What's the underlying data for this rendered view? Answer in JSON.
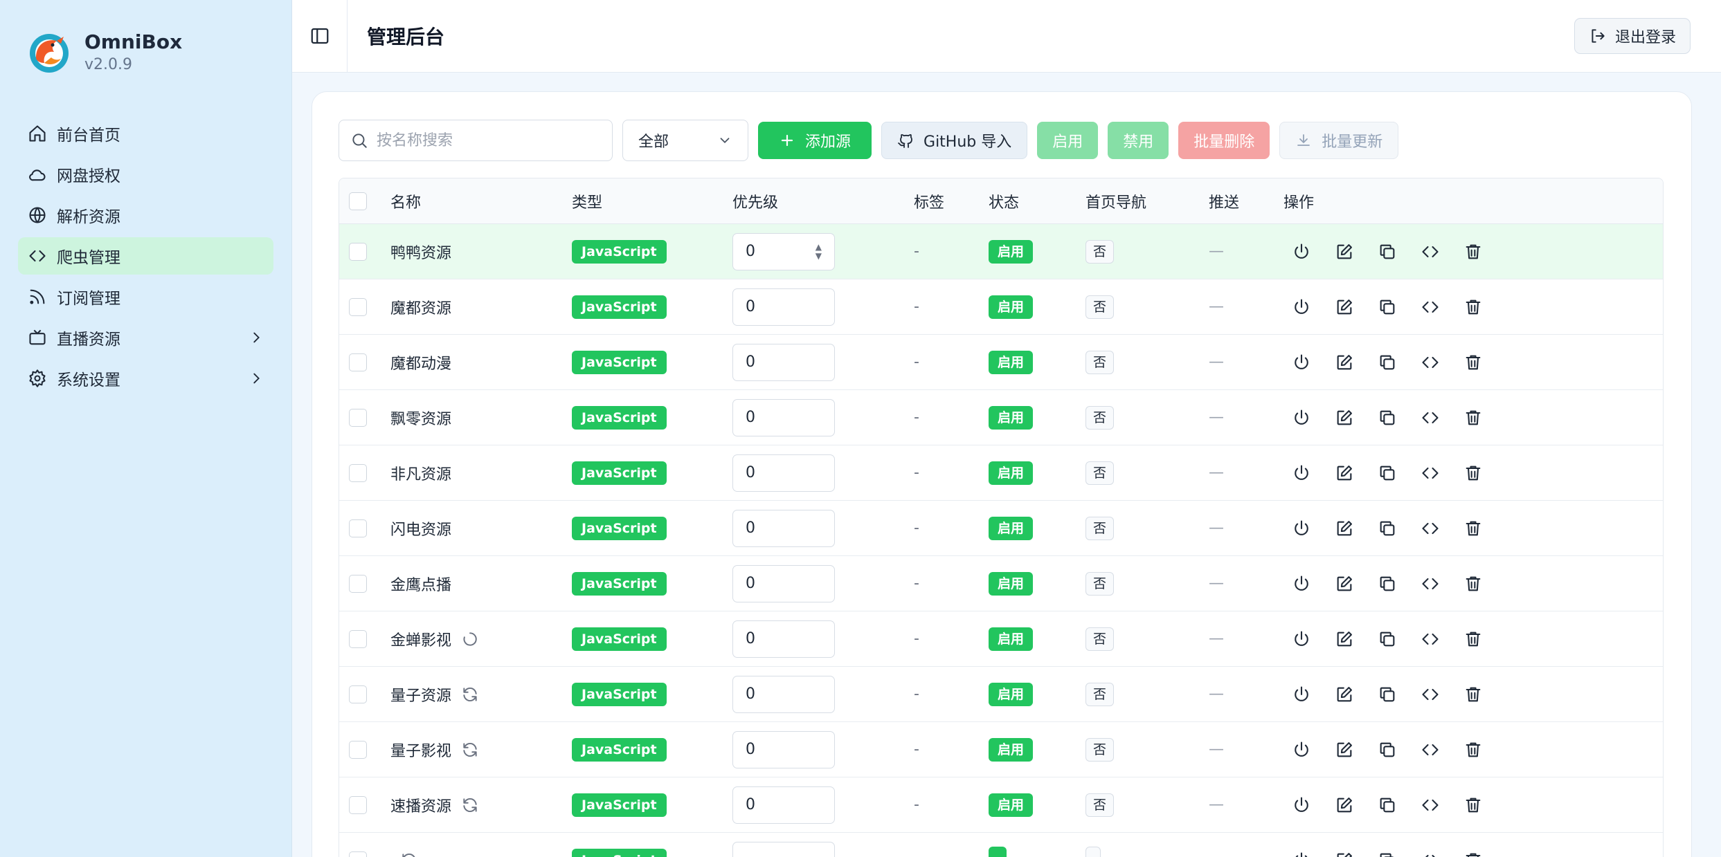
{
  "brand": {
    "name": "OmniBox",
    "version": "v2.0.9"
  },
  "sidebar": {
    "items": [
      {
        "label": "前台首页",
        "icon": "home-icon"
      },
      {
        "label": "网盘授权",
        "icon": "cloud-icon"
      },
      {
        "label": "解析资源",
        "icon": "globe-icon"
      },
      {
        "label": "爬虫管理",
        "icon": "code-icon",
        "active": true
      },
      {
        "label": "订阅管理",
        "icon": "rss-icon"
      },
      {
        "label": "直播资源",
        "icon": "tv-icon",
        "expandable": true
      },
      {
        "label": "系统设置",
        "icon": "gear-icon",
        "expandable": true
      }
    ]
  },
  "header": {
    "title": "管理后台",
    "logout_label": "退出登录"
  },
  "toolbar": {
    "search_placeholder": "按名称搜索",
    "filter_value": "全部",
    "add_label": "添加源",
    "github_label": "GitHub 导入",
    "enable_label": "启用",
    "disable_label": "禁用",
    "batch_delete_label": "批量删除",
    "batch_update_label": "批量更新"
  },
  "table": {
    "columns": [
      "名称",
      "类型",
      "优先级",
      "标签",
      "状态",
      "首页导航",
      "推送",
      "操作"
    ],
    "rows": [
      {
        "name": "鸭鸭资源",
        "type": "JavaScript",
        "priority": "0",
        "tag": "-",
        "status": "启用",
        "home": "否",
        "push": "—",
        "highlight": true
      },
      {
        "name": "魔都资源",
        "type": "JavaScript",
        "priority": "0",
        "tag": "-",
        "status": "启用",
        "home": "否",
        "push": "—"
      },
      {
        "name": "魔都动漫",
        "type": "JavaScript",
        "priority": "0",
        "tag": "-",
        "status": "启用",
        "home": "否",
        "push": "—"
      },
      {
        "name": "飘零资源",
        "type": "JavaScript",
        "priority": "0",
        "tag": "-",
        "status": "启用",
        "home": "否",
        "push": "—"
      },
      {
        "name": "非凡资源",
        "type": "JavaScript",
        "priority": "0",
        "tag": "-",
        "status": "启用",
        "home": "否",
        "push": "—"
      },
      {
        "name": "闪电资源",
        "type": "JavaScript",
        "priority": "0",
        "tag": "-",
        "status": "启用",
        "home": "否",
        "push": "—"
      },
      {
        "name": "金鹰点播",
        "type": "JavaScript",
        "priority": "0",
        "tag": "-",
        "status": "启用",
        "home": "否",
        "push": "—"
      },
      {
        "name": "金蝉影视",
        "type": "JavaScript",
        "priority": "0",
        "tag": "-",
        "status": "启用",
        "home": "否",
        "push": "—",
        "indicator": "loading-spinner-icon"
      },
      {
        "name": "量子资源",
        "type": "JavaScript",
        "priority": "0",
        "tag": "-",
        "status": "启用",
        "home": "否",
        "push": "—",
        "indicator": "refresh-icon"
      },
      {
        "name": "量子影视",
        "type": "JavaScript",
        "priority": "0",
        "tag": "-",
        "status": "启用",
        "home": "否",
        "push": "—",
        "indicator": "refresh-icon"
      },
      {
        "name": "速播资源",
        "type": "JavaScript",
        "priority": "0",
        "tag": "-",
        "status": "启用",
        "home": "否",
        "push": "—",
        "indicator": "refresh-icon"
      },
      {
        "name": "",
        "type": "JavaScript",
        "priority": "",
        "tag": "",
        "status": "",
        "home": "",
        "push": "",
        "indicator": "refresh-icon"
      }
    ],
    "row_actions": [
      "power-icon",
      "edit-icon",
      "copy-icon",
      "code-icon",
      "trash-icon"
    ]
  },
  "colors": {
    "accent": "#22c55e",
    "sidebar_bg": "#dbeefb",
    "active_item_bg": "#cdf4de",
    "danger_soft": "#f5a3a3"
  }
}
